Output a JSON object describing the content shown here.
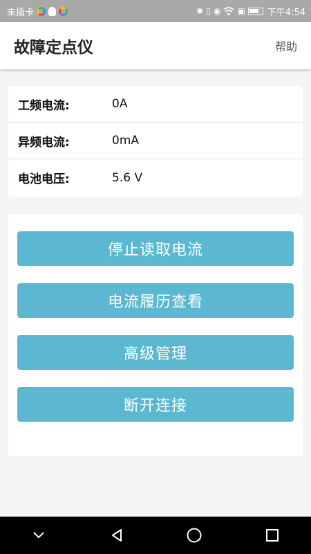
{
  "status_bar": {
    "carrier": "未插卡",
    "time": "下午4:54",
    "icons": [
      "bluetooth-icon",
      "vibrate-icon",
      "eye-icon",
      "wifi-icon",
      "sim-icon",
      "battery-icon"
    ]
  },
  "app_bar": {
    "title": "故障定点仪",
    "help": "帮助"
  },
  "readings": [
    {
      "label": "工频电流:",
      "value": "0A"
    },
    {
      "label": "异频电流:",
      "value": "0mA"
    },
    {
      "label": "电池电压:",
      "value": "5.6 V"
    }
  ],
  "actions": [
    {
      "label": "停止读取电流"
    },
    {
      "label": "电流履历查看"
    },
    {
      "label": "高级管理"
    },
    {
      "label": "断开连接"
    }
  ],
  "nav_bar": {
    "icons": [
      "collapse-icon",
      "back-icon",
      "home-icon",
      "recents-icon"
    ]
  },
  "colors": {
    "status_bar": "#a9a9a9",
    "button": "#5bb8d0",
    "background": "#f4f4f4"
  }
}
